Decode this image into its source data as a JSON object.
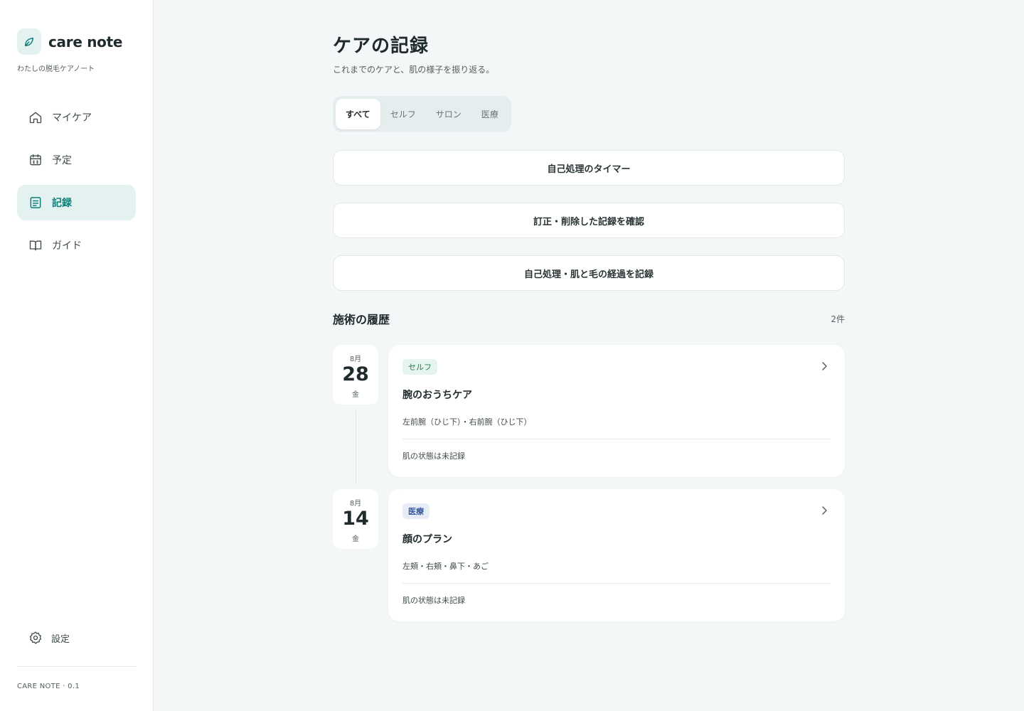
{
  "app": {
    "name": "care note",
    "subtitle": "わたしの脱毛ケアノート",
    "version": "CARE NOTE · 0.1",
    "accent": "#0f7f78"
  },
  "sidebar": {
    "items": [
      {
        "label": "マイケア",
        "icon": "home-icon"
      },
      {
        "label": "予定",
        "icon": "calendar-icon"
      },
      {
        "label": "記録",
        "icon": "notes-icon",
        "active": true
      },
      {
        "label": "ガイド",
        "icon": "book-icon"
      }
    ],
    "settings_label": "設定"
  },
  "page": {
    "title": "ケアの記録",
    "subtitle": "これまでのケアと、肌の様子を振り返る。"
  },
  "filters": {
    "options": [
      "すべて",
      "セルフ",
      "サロン",
      "医療"
    ],
    "selected": "すべて"
  },
  "actions": {
    "timer": "自己処理のタイマー",
    "corrections": "訂正・削除した記録を確認",
    "log_progress": "自己処理・肌と毛の経過を記録"
  },
  "history": {
    "title": "施術の履歴",
    "count": "2件",
    "entries": [
      {
        "month": "8月",
        "day": "28",
        "weekday": "金",
        "type": "セルフ",
        "title": "腕のおうちケア",
        "parts": "左前腕（ひじ下）・右前腕（ひじ下）",
        "skin": "肌の状態は未記録"
      },
      {
        "month": "8月",
        "day": "14",
        "weekday": "金",
        "type": "医療",
        "title": "顔のプラン",
        "parts": "左頬・右頬・鼻下・あご",
        "skin": "肌の状態は未記録"
      }
    ]
  }
}
